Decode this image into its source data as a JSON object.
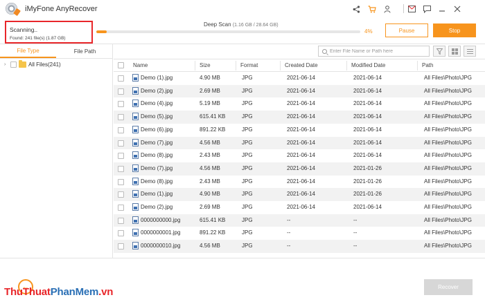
{
  "app": {
    "title": "iMyFone AnyRecover"
  },
  "titlebar_icons": [
    "share-icon",
    "cart-icon",
    "user-icon",
    "mail-icon",
    "feedback-icon",
    "minimize-icon",
    "close-icon"
  ],
  "scan": {
    "status": "Scanning..",
    "found": "Found: 241 file(s) (1.87 GB)",
    "mode": "Deep Scan",
    "size_progress": "(1.16 GB / 28.64 GB)",
    "percent_label": "4%",
    "progress_fraction": 0.04,
    "pause_label": "Pause",
    "stop_label": "Stop"
  },
  "left_panel": {
    "tabs": [
      "File Type",
      "File Path"
    ],
    "active_tab": "File Type",
    "tree_root": "All Files(241)"
  },
  "search": {
    "placeholder": "Enter File Name or Path here"
  },
  "table": {
    "columns": [
      "Name",
      "Size",
      "Format",
      "Created Date",
      "Modified Date",
      "Path"
    ],
    "rows": [
      [
        "Demo (1).jpg",
        "4.90 MB",
        "JPG",
        "2021-06-14",
        "2021-06-14",
        "All Files\\Photo\\JPG"
      ],
      [
        "Demo (2).jpg",
        "2.69 MB",
        "JPG",
        "2021-06-14",
        "2021-06-14",
        "All Files\\Photo\\JPG"
      ],
      [
        "Demo (4).jpg",
        "5.19 MB",
        "JPG",
        "2021-06-14",
        "2021-06-14",
        "All Files\\Photo\\JPG"
      ],
      [
        "Demo (5).jpg",
        "615.41 KB",
        "JPG",
        "2021-06-14",
        "2021-06-14",
        "All Files\\Photo\\JPG"
      ],
      [
        "Demo (6).jpg",
        "891.22 KB",
        "JPG",
        "2021-06-14",
        "2021-06-14",
        "All Files\\Photo\\JPG"
      ],
      [
        "Demo (7).jpg",
        "4.56 MB",
        "JPG",
        "2021-06-14",
        "2021-06-14",
        "All Files\\Photo\\JPG"
      ],
      [
        "Demo (8).jpg",
        "2.43 MB",
        "JPG",
        "2021-06-14",
        "2021-06-14",
        "All Files\\Photo\\JPG"
      ],
      [
        "Demo (7).jpg",
        "4.56 MB",
        "JPG",
        "2021-06-14",
        "2021-01-26",
        "All Files\\Photo\\JPG"
      ],
      [
        "Demo (8).jpg",
        "2.43 MB",
        "JPG",
        "2021-06-14",
        "2021-01-26",
        "All Files\\Photo\\JPG"
      ],
      [
        "Demo (1).jpg",
        "4.90 MB",
        "JPG",
        "2021-06-14",
        "2021-01-26",
        "All Files\\Photo\\JPG"
      ],
      [
        "Demo (2).jpg",
        "2.69 MB",
        "JPG",
        "2021-06-14",
        "2021-06-14",
        "All Files\\Photo\\JPG"
      ],
      [
        "0000000000.jpg",
        "615.41 KB",
        "JPG",
        "--",
        "--",
        "All Files\\Photo\\JPG"
      ],
      [
        "0000000001.jpg",
        "891.22 KB",
        "JPG",
        "--",
        "--",
        "All Files\\Photo\\JPG"
      ],
      [
        "0000000010.jpg",
        "4.56 MB",
        "JPG",
        "--",
        "--",
        "All Files\\Photo\\JPG"
      ]
    ]
  },
  "footer": {
    "recover_label": "Recover",
    "watermark": [
      "Thu",
      "Thuat",
      "PhanMem",
      ".vn"
    ]
  },
  "colors": {
    "accent": "#f7941d",
    "highlight_box": "#e8262a",
    "disabled": "#d7d7d7"
  }
}
